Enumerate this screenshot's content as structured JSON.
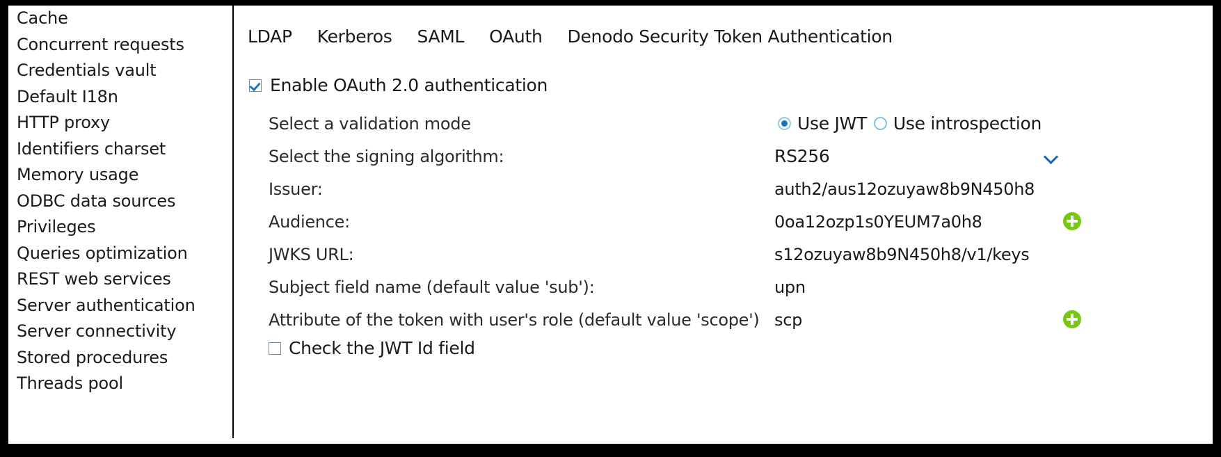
{
  "sidebar": {
    "items": [
      {
        "label": "Cache"
      },
      {
        "label": "Concurrent requests"
      },
      {
        "label": "Credentials vault"
      },
      {
        "label": "Default I18n"
      },
      {
        "label": "HTTP proxy"
      },
      {
        "label": "Identifiers charset"
      },
      {
        "label": "Memory usage"
      },
      {
        "label": "ODBC data sources"
      },
      {
        "label": "Privileges"
      },
      {
        "label": "Queries optimization"
      },
      {
        "label": "REST web services"
      },
      {
        "label": "Server authentication"
      },
      {
        "label": "Server connectivity"
      },
      {
        "label": "Stored procedures"
      },
      {
        "label": "Threads pool"
      }
    ]
  },
  "tabs": [
    {
      "label": "LDAP",
      "selected": false
    },
    {
      "label": "Kerberos",
      "selected": false
    },
    {
      "label": "SAML",
      "selected": false
    },
    {
      "label": "OAuth",
      "selected": true
    },
    {
      "label": "Denodo Security Token Authentication",
      "selected": false
    }
  ],
  "enable": {
    "label": "Enable OAuth 2.0 authentication",
    "checked": true
  },
  "validation_mode": {
    "label": "Select a validation mode",
    "options": [
      {
        "label": "Use JWT",
        "selected": true
      },
      {
        "label": "Use introspection",
        "selected": false
      }
    ]
  },
  "signing_algorithm": {
    "label": "Select the signing algorithm:",
    "value": "RS256",
    "icon": "chevron-down-icon"
  },
  "fields": [
    {
      "label": "Issuer:",
      "value": "auth2/aus12ozuyaw8b9N450h8",
      "clipped": true,
      "add_icon": false
    },
    {
      "label": "Audience:",
      "value": "0oa12ozp1s0YEUM7a0h8",
      "clipped": false,
      "add_icon": true
    },
    {
      "label": "JWKS URL:",
      "value": "s12ozuyaw8b9N450h8/v1/keys",
      "clipped": true,
      "add_icon": false
    },
    {
      "label": "Subject field name (default value 'sub'):",
      "value": "upn",
      "clipped": false,
      "add_icon": false
    },
    {
      "label": "Attribute of the token with user's role (default value 'scope')",
      "value": "scp",
      "clipped": false,
      "add_icon": true
    }
  ],
  "check_jwt_id": {
    "label": "Check the JWT Id field",
    "checked": false
  },
  "colors": {
    "accent_blue": "#1076b5",
    "add_green": "#76c910",
    "chevron_blue": "#1565c0",
    "text": "#1a1a1a",
    "frame": "#000000"
  },
  "icons": {
    "add": "plus-circle-icon",
    "dropdown": "chevron-down-icon"
  }
}
